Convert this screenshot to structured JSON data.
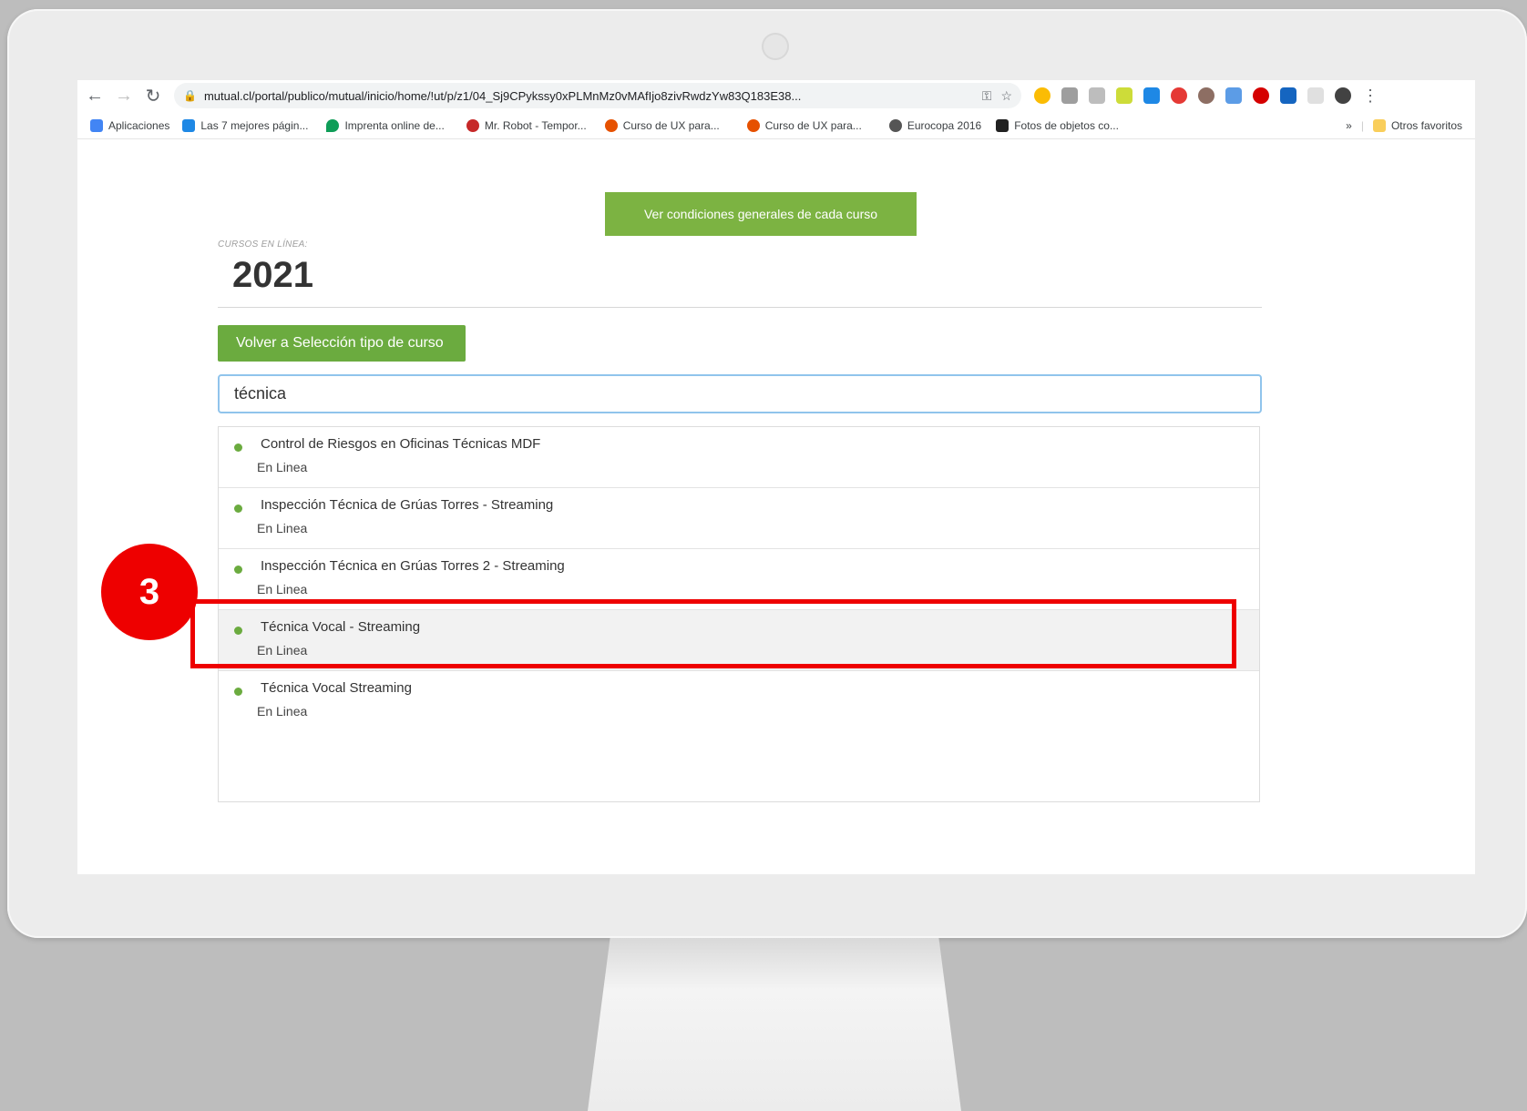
{
  "browser": {
    "url": "mutual.cl/portal/publico/mutual/inicio/home/!ut/p/z1/04_Sj9CPykssy0xPLMnMz0vMAfIjo8zivRwdzYw83Q183E38...",
    "bookmarks": [
      {
        "label": "Aplicaciones",
        "icon": "apps-grid-icon",
        "color": "#4285f4"
      },
      {
        "label": "Las 7 mejores págin...",
        "icon": "bookmark-favicon",
        "color": "#1e88e5"
      },
      {
        "label": "Imprenta online de...",
        "icon": "drop-icon",
        "color": "#0f9d58"
      },
      {
        "label": "Mr. Robot - Tempor...",
        "icon": "bookmark-favicon",
        "color": "#c62828"
      },
      {
        "label": "Curso de UX para...",
        "icon": "flame-icon",
        "color": "#e65100"
      },
      {
        "label": "Curso de UX para...",
        "icon": "flame-icon",
        "color": "#e65100"
      },
      {
        "label": "Eurocopa 2016",
        "icon": "globe-icon",
        "color": "#555555"
      },
      {
        "label": "Fotos de objetos co...",
        "icon": "bookmark-favicon",
        "color": "#212121"
      }
    ],
    "bookmarks_overflow": "»",
    "other_bookmarks": "Otros favoritos"
  },
  "page": {
    "cta_label": "Ver condiciones generales de cada curso",
    "kicker": "CURSOS EN LÍNEA:",
    "year": "2021",
    "back_label": "Volver a Selección tipo de curso",
    "search_value": "técnica",
    "results": [
      {
        "title": "Control de Riesgos en Oficinas Técnicas MDF",
        "sub": "En Linea"
      },
      {
        "title": "Inspección Técnica de Grúas Torres - Streaming",
        "sub": "En Linea"
      },
      {
        "title": "Inspección Técnica en Grúas Torres 2 - Streaming",
        "sub": "En Linea"
      },
      {
        "title": "Técnica Vocal - Streaming",
        "sub": "En Linea"
      },
      {
        "title": "Técnica Vocal Streaming",
        "sub": "En Linea"
      }
    ]
  },
  "annotation": {
    "step": "3",
    "color": "#ee0000"
  },
  "colors": {
    "accent_green": "#6bab3f",
    "focus_blue": "#90c4ec"
  }
}
